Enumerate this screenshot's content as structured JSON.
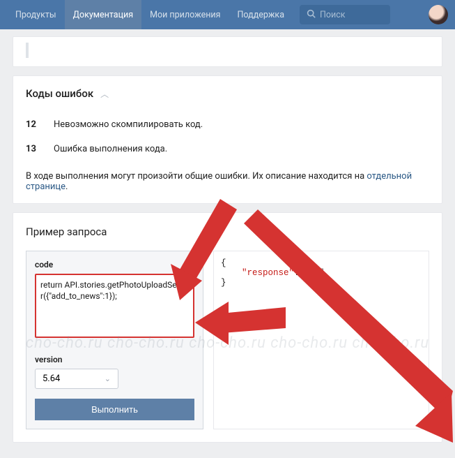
{
  "nav": {
    "items": [
      "Продукты",
      "Документация",
      "Мои приложения",
      "Поддержка"
    ],
    "active_index": 1,
    "search_placeholder": "Поиск"
  },
  "errors_section": {
    "title": "Коды ошибок",
    "rows": [
      {
        "code": "12",
        "text": "Невозможно скомпилировать код."
      },
      {
        "code": "13",
        "text": "Ошибка выполнения кода."
      }
    ],
    "common_note_prefix": "В ходе выполнения могут произойти общие ошибки. Их описание находится на ",
    "common_note_link": "отдельной странице",
    "common_note_suffix": "."
  },
  "example_section": {
    "title": "Пример запроса",
    "code_label": "code",
    "code_value": "return API.stories.getPhotoUploadServer({\"add_to_news\":1});",
    "version_label": "version",
    "version_value": "5.64",
    "run_label": "Выполнить",
    "response": {
      "open": "{",
      "key": "\"response\"",
      "colon": ": ",
      "value": "null",
      "close": "}"
    }
  },
  "watermark": "cho-cho.ru  cho-cho.ru  cho-cho.ru  cho-cho.ru  cho-cho.ru"
}
